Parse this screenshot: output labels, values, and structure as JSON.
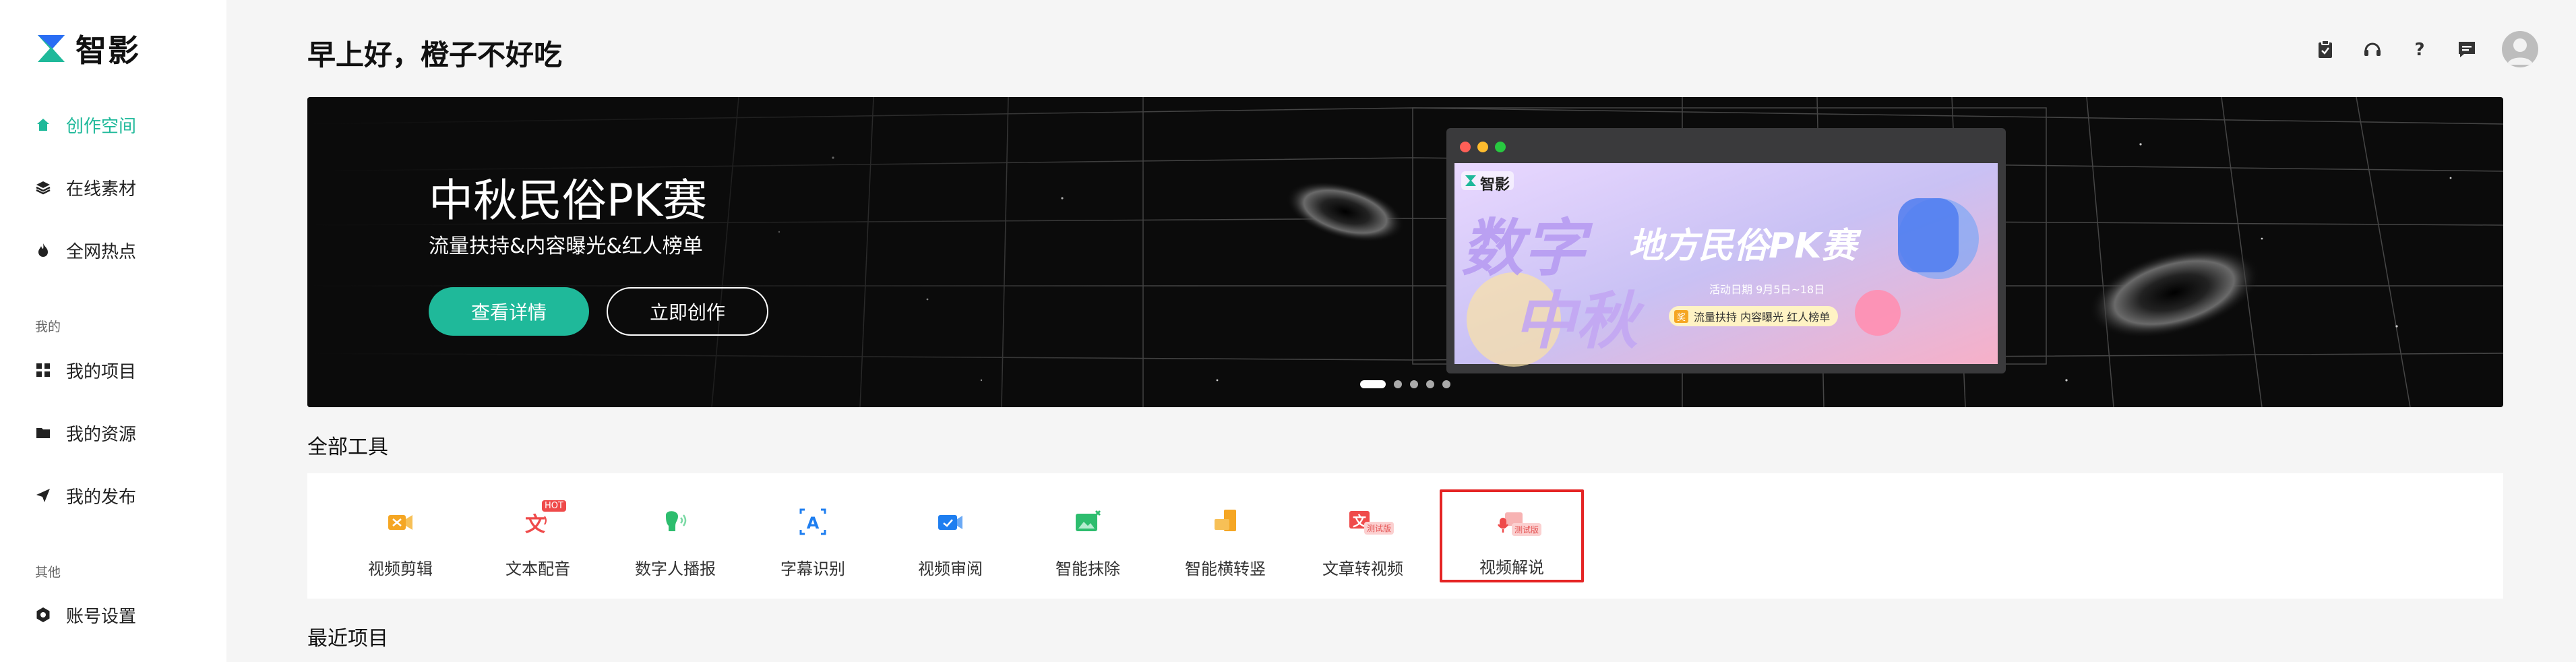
{
  "app": {
    "name": "智影"
  },
  "sidebar": {
    "items": [
      {
        "label": "创作空间",
        "icon": "home-icon",
        "active": true
      },
      {
        "label": "在线素材",
        "icon": "layers-icon",
        "active": false
      },
      {
        "label": "全网热点",
        "icon": "fire-icon",
        "active": false
      }
    ],
    "section_mine": "我的",
    "mine_items": [
      {
        "label": "我的项目",
        "icon": "grid-icon"
      },
      {
        "label": "我的资源",
        "icon": "folder-icon"
      },
      {
        "label": "我的发布",
        "icon": "send-icon"
      }
    ],
    "section_other": "其他",
    "other_items": [
      {
        "label": "账号设置",
        "icon": "settings-icon"
      }
    ]
  },
  "header": {
    "greeting": "早上好，橙子不好吃",
    "icons": [
      "clipboard-icon",
      "headset-icon",
      "help-icon",
      "message-icon",
      "avatar"
    ]
  },
  "banner": {
    "title": "中秋民俗PK赛",
    "subtitle": "流量扶持&内容曝光&红人榜单",
    "primary_button": "查看详情",
    "secondary_button": "立即创作",
    "preview": {
      "logo": "智影",
      "headline_left_1": "数字",
      "headline_left_2": "中秋",
      "headline_right": "地方民俗PK赛",
      "date": "活动日期 9月5日~18日",
      "perks": "流量扶持 内容曝光 红人榜单",
      "perk_tag": "奖"
    },
    "slide_count": 5,
    "active_slide": 1
  },
  "tools_section": {
    "title": "全部工具",
    "items": [
      {
        "label": "视频剪辑",
        "icon": "video-edit-icon",
        "color": "#f5a623",
        "tag": ""
      },
      {
        "label": "文本配音",
        "icon": "text-voice-icon",
        "color": "#ef4a4a",
        "tag": "HOT"
      },
      {
        "label": "数字人播报",
        "icon": "digital-human-icon",
        "color": "#2dbd6e",
        "tag": ""
      },
      {
        "label": "字幕识别",
        "icon": "subtitle-icon",
        "color": "#1e7ef0",
        "tag": ""
      },
      {
        "label": "视频审阅",
        "icon": "video-review-icon",
        "color": "#1e7ef0",
        "tag": ""
      },
      {
        "label": "智能抹除",
        "icon": "erase-icon",
        "color": "#2dbd6e",
        "tag": ""
      },
      {
        "label": "智能横转竖",
        "icon": "rotate-icon",
        "color": "#f5a623",
        "tag": ""
      },
      {
        "label": "文章转视频",
        "icon": "article-video-icon",
        "color": "#ef4a4a",
        "tag": "测试版"
      },
      {
        "label": "视频解说",
        "icon": "video-narrate-icon",
        "color": "#ef4a4a",
        "tag": "测试版",
        "selected": true
      }
    ]
  },
  "recent_section": {
    "title": "最近项目"
  },
  "colors": {
    "accent": "#1fb99a",
    "selection": "#e52424"
  }
}
